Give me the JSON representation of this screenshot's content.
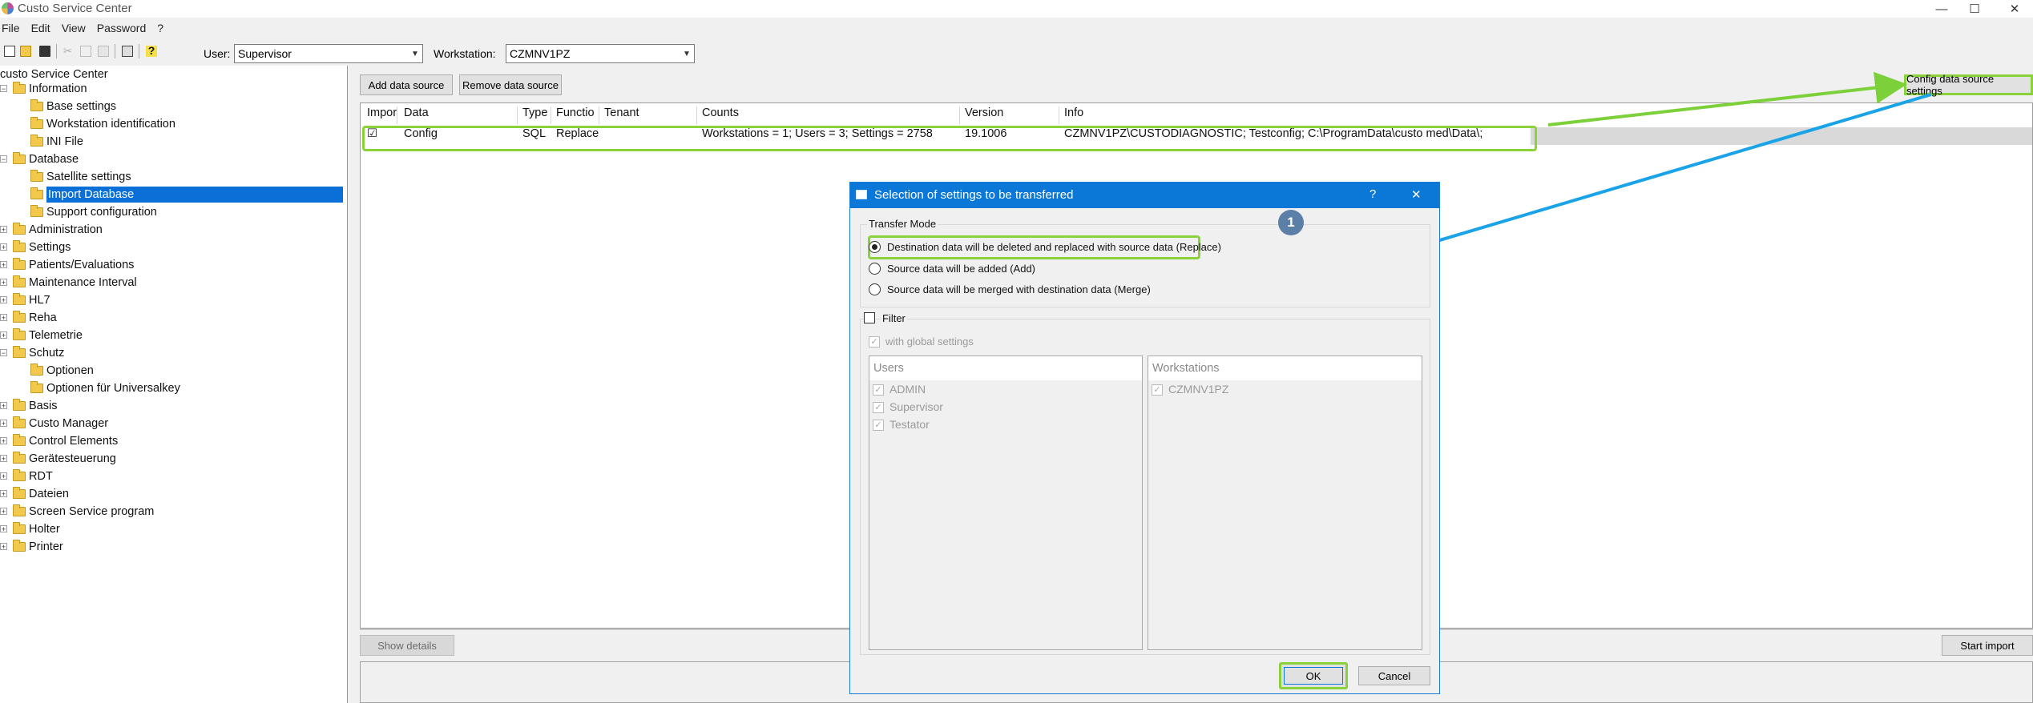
{
  "app": {
    "title": "Custo Service Center"
  },
  "window_controls": {
    "minimize": "—",
    "maximize": "☐",
    "close": "✕"
  },
  "menu": [
    "File",
    "Edit",
    "View",
    "Password",
    "?"
  ],
  "toolbar": {
    "user_label": "User:",
    "user_value": "Supervisor",
    "workstation_label": "Workstation:",
    "workstation_value": "CZMNV1PZ"
  },
  "tree": {
    "root": "custo Service Center",
    "items": [
      "Information",
      "Base settings",
      "Workstation identification",
      "INI File",
      "Database",
      "Satellite settings",
      "Import Database",
      "Support configuration",
      "Administration",
      "Settings",
      "Patients/Evaluations",
      "Maintenance Interval",
      "HL7",
      "Reha",
      "Telemetrie",
      "Schutz",
      "Optionen",
      "Optionen für Universalkey",
      "Basis",
      "Custo Manager",
      "Control Elements",
      "Gerätesteuerung",
      "RDT",
      "Dateien",
      "Screen Service program",
      "Holter",
      "Printer"
    ]
  },
  "buttons": {
    "add_data_source": "Add data source",
    "remove_data_source": "Remove data source",
    "config_data_source_settings": "Config data source settings",
    "show_details": "Show details",
    "start_import": "Start import"
  },
  "grid": {
    "columns": [
      "Impor",
      "Data",
      "Type",
      "Functio",
      "Tenant",
      "Counts",
      "Version",
      "Info"
    ],
    "rows": [
      {
        "import": "☑",
        "data": "Config",
        "type": "SQL",
        "function": "Replace",
        "tenant": "",
        "counts": "Workstations = 1; Users = 3; Settings = 2758",
        "version": "19.1006",
        "info": "CZMNV1PZ\\CUSTODIAGNOSTIC; Testconfig; C:\\ProgramData\\custo med\\Data\\;"
      }
    ]
  },
  "dialog": {
    "title": "Selection of settings to be transferred",
    "help": "?",
    "close": "✕",
    "transfer_mode_label": "Transfer Mode",
    "options": [
      "Destination data will be deleted and replaced with source data (Replace)",
      "Source data will be added (Add)",
      "Source data will be merged with destination data (Merge)"
    ],
    "selected_option": 0,
    "filter_label": "Filter",
    "with_global_settings": "with global settings",
    "users_header": "Users",
    "users": [
      "ADMIN",
      "Supervisor",
      "Testator"
    ],
    "workstations_header": "Workstations",
    "workstations": [
      "CZMNV1PZ"
    ],
    "ok": "OK",
    "cancel": "Cancel"
  },
  "annotation": {
    "step_badge": "1"
  },
  "colors": {
    "highlight_green": "#8bd23a",
    "arrow_green": "#7cd03a",
    "arrow_blue": "#1aa3e6",
    "selection_blue": "#0b6fd8",
    "badge": "#5b7fa6"
  }
}
